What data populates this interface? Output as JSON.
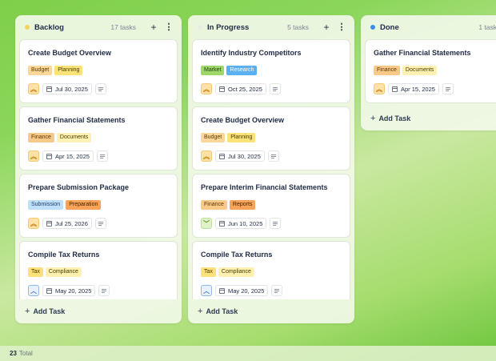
{
  "colors": {
    "backlog_dot": "#f4d35e",
    "in_progress_dot": "#e8ece6",
    "done_dot": "#3b8ee8"
  },
  "columns": [
    {
      "title": "Backlog",
      "count": "17 tasks",
      "add_task": "Add Task",
      "cards": [
        {
          "title": "Create Budget Overview",
          "tags": [
            "Budget",
            "Planning"
          ],
          "priority": "high",
          "date": "Jul 30, 2025"
        },
        {
          "title": "Gather Financial Statements",
          "tags": [
            "Finance",
            "Documents"
          ],
          "priority": "high",
          "date": "Apr 15, 2025"
        },
        {
          "title": "Prepare Submission Package",
          "tags": [
            "Submission",
            "Preparation"
          ],
          "priority": "high",
          "date": "Jul 25, 2026"
        },
        {
          "title": "Compile Tax Returns",
          "tags": [
            "Tax",
            "Compliance"
          ],
          "priority": "medium",
          "date": "May 20, 2025"
        }
      ]
    },
    {
      "title": "In Progress",
      "count": "5 tasks",
      "add_task": "Add Task",
      "cards": [
        {
          "title": "Identify Industry Competitors",
          "tags": [
            "Market",
            "Research"
          ],
          "priority": "high",
          "date": "Oct 25, 2025"
        },
        {
          "title": "Create Budget Overview",
          "tags": [
            "Budget",
            "Planning"
          ],
          "priority": "high",
          "date": "Jul 30, 2025"
        },
        {
          "title": "Prepare Interim Financial Statements",
          "tags": [
            "Finance",
            "Reports"
          ],
          "priority": "low",
          "date": "Jun 10, 2025"
        },
        {
          "title": "Compile Tax Returns",
          "tags": [
            "Tax",
            "Compliance"
          ],
          "priority": "medium",
          "date": "May 20, 2025"
        }
      ]
    },
    {
      "title": "Done",
      "count": "1 task",
      "add_task": "Add Task",
      "cards": [
        {
          "title": "Gather Financial Statements",
          "tags": [
            "Finance",
            "Documents"
          ],
          "priority": "high",
          "date": "Apr 15, 2025"
        }
      ]
    }
  ],
  "footer": {
    "total_count": "23",
    "total_label": "Total"
  }
}
